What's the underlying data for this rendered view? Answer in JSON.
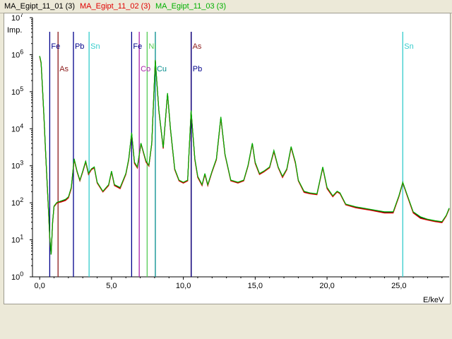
{
  "legend": [
    {
      "label": "MA_Egipt_11_01 (3)",
      "color": "#000000"
    },
    {
      "label": "MA_Egipt_11_02 (3)",
      "color": "#e00000"
    },
    {
      "label": "MA_Egipt_11_03 (3)",
      "color": "#00b000"
    }
  ],
  "chart_data": {
    "type": "line",
    "ylabel": "Imp.",
    "xlabel": "E/keV",
    "yscale": "log",
    "ylim": [
      1,
      10000000
    ],
    "xlim": [
      -0.5,
      28.5
    ],
    "x_ticks": [
      0,
      5,
      10,
      15,
      20,
      25
    ],
    "x_tick_labels": [
      "0,0",
      "5,0",
      "10,0",
      "15,0",
      "20,0",
      "25,0"
    ],
    "y_ticks": [
      1,
      10,
      100,
      1000,
      10000,
      100000,
      1000000,
      10000000
    ],
    "y_tick_labels": [
      "10^0",
      "10^1",
      "10^2",
      "10^3",
      "10^4",
      "10^5",
      "10^6",
      "10^7"
    ],
    "series_colors": [
      "#000000",
      "#e00000",
      "#00b000"
    ],
    "series": [
      {
        "name": "MA_Egipt_11_01 (3)",
        "points": [
          [
            0.0,
            900000
          ],
          [
            0.1,
            600000
          ],
          [
            0.2,
            120000
          ],
          [
            0.3,
            20000
          ],
          [
            0.4,
            3000
          ],
          [
            0.5,
            500
          ],
          [
            0.6,
            80
          ],
          [
            0.7,
            12
          ],
          [
            0.8,
            4
          ],
          [
            0.9,
            30
          ],
          [
            1.0,
            80
          ],
          [
            1.2,
            100
          ],
          [
            1.5,
            110
          ],
          [
            1.8,
            120
          ],
          [
            2.0,
            140
          ],
          [
            2.2,
            250
          ],
          [
            2.4,
            1500
          ],
          [
            2.6,
            700
          ],
          [
            2.8,
            400
          ],
          [
            3.0,
            700
          ],
          [
            3.2,
            1300
          ],
          [
            3.4,
            600
          ],
          [
            3.6,
            800
          ],
          [
            3.8,
            900
          ],
          [
            4.0,
            350
          ],
          [
            4.4,
            200
          ],
          [
            4.8,
            300
          ],
          [
            5.0,
            700
          ],
          [
            5.2,
            300
          ],
          [
            5.6,
            250
          ],
          [
            6.0,
            600
          ],
          [
            6.2,
            1500
          ],
          [
            6.4,
            7500
          ],
          [
            6.6,
            1200
          ],
          [
            6.8,
            900
          ],
          [
            7.05,
            4000
          ],
          [
            7.4,
            1300
          ],
          [
            7.6,
            1000
          ],
          [
            7.8,
            4000
          ],
          [
            8.05,
            700000
          ],
          [
            8.3,
            30000
          ],
          [
            8.6,
            3000
          ],
          [
            8.9,
            90000
          ],
          [
            9.1,
            10000
          ],
          [
            9.4,
            800
          ],
          [
            9.7,
            400
          ],
          [
            10.0,
            350
          ],
          [
            10.3,
            400
          ],
          [
            10.54,
            30000
          ],
          [
            10.8,
            1500
          ],
          [
            11.0,
            500
          ],
          [
            11.3,
            300
          ],
          [
            11.5,
            600
          ],
          [
            11.7,
            300
          ],
          [
            12.0,
            700
          ],
          [
            12.3,
            1500
          ],
          [
            12.61,
            20000
          ],
          [
            12.9,
            2000
          ],
          [
            13.3,
            400
          ],
          [
            13.8,
            350
          ],
          [
            14.2,
            400
          ],
          [
            14.5,
            1000
          ],
          [
            14.8,
            4000
          ],
          [
            15.0,
            1200
          ],
          [
            15.3,
            600
          ],
          [
            15.6,
            700
          ],
          [
            16.0,
            900
          ],
          [
            16.3,
            2500
          ],
          [
            16.6,
            900
          ],
          [
            16.9,
            500
          ],
          [
            17.2,
            800
          ],
          [
            17.5,
            3200
          ],
          [
            17.8,
            1200
          ],
          [
            18.0,
            400
          ],
          [
            18.4,
            200
          ],
          [
            18.8,
            180
          ],
          [
            19.3,
            170
          ],
          [
            19.7,
            900
          ],
          [
            20.0,
            250
          ],
          [
            20.4,
            150
          ],
          [
            20.7,
            200
          ],
          [
            20.9,
            180
          ],
          [
            21.3,
            90
          ],
          [
            22.0,
            75
          ],
          [
            23.0,
            65
          ],
          [
            24.0,
            55
          ],
          [
            24.6,
            55
          ],
          [
            25.0,
            150
          ],
          [
            25.27,
            350
          ],
          [
            25.6,
            150
          ],
          [
            26.0,
            55
          ],
          [
            26.5,
            40
          ],
          [
            27.0,
            35
          ],
          [
            27.5,
            32
          ],
          [
            28.0,
            30
          ],
          [
            28.3,
            45
          ],
          [
            28.5,
            70
          ]
        ]
      },
      {
        "name": "MA_Egipt_11_02 (3)",
        "points": [
          [
            0.0,
            880000
          ],
          [
            0.1,
            580000
          ],
          [
            0.2,
            115000
          ],
          [
            0.3,
            19000
          ],
          [
            0.4,
            2800
          ],
          [
            0.5,
            480
          ],
          [
            0.6,
            75
          ],
          [
            0.7,
            11
          ],
          [
            0.8,
            4
          ],
          [
            0.9,
            28
          ],
          [
            1.0,
            78
          ],
          [
            1.2,
            98
          ],
          [
            1.5,
            105
          ],
          [
            1.8,
            115
          ],
          [
            2.0,
            135
          ],
          [
            2.2,
            240
          ],
          [
            2.4,
            1450
          ],
          [
            2.6,
            680
          ],
          [
            2.8,
            390
          ],
          [
            3.0,
            680
          ],
          [
            3.2,
            1250
          ],
          [
            3.4,
            580
          ],
          [
            3.6,
            780
          ],
          [
            3.8,
            870
          ],
          [
            4.0,
            340
          ],
          [
            4.4,
            195
          ],
          [
            4.8,
            290
          ],
          [
            5.0,
            680
          ],
          [
            5.2,
            290
          ],
          [
            5.6,
            240
          ],
          [
            6.0,
            580
          ],
          [
            6.2,
            1450
          ],
          [
            6.4,
            7300
          ],
          [
            6.6,
            1150
          ],
          [
            6.8,
            870
          ],
          [
            7.05,
            3900
          ],
          [
            7.4,
            1250
          ],
          [
            7.6,
            980
          ],
          [
            7.8,
            3900
          ],
          [
            8.05,
            690000
          ],
          [
            8.3,
            29000
          ],
          [
            8.6,
            2900
          ],
          [
            8.9,
            88000
          ],
          [
            9.1,
            9800
          ],
          [
            9.4,
            780
          ],
          [
            9.7,
            390
          ],
          [
            10.0,
            340
          ],
          [
            10.3,
            390
          ],
          [
            10.54,
            29000
          ],
          [
            10.8,
            1450
          ],
          [
            11.0,
            480
          ],
          [
            11.3,
            290
          ],
          [
            11.5,
            580
          ],
          [
            11.7,
            290
          ],
          [
            12.0,
            680
          ],
          [
            12.3,
            1450
          ],
          [
            12.61,
            19500
          ],
          [
            12.9,
            1950
          ],
          [
            13.3,
            390
          ],
          [
            13.8,
            340
          ],
          [
            14.2,
            390
          ],
          [
            14.5,
            980
          ],
          [
            14.8,
            3900
          ],
          [
            15.0,
            1150
          ],
          [
            15.3,
            580
          ],
          [
            15.6,
            680
          ],
          [
            16.0,
            880
          ],
          [
            16.3,
            2400
          ],
          [
            16.6,
            880
          ],
          [
            16.9,
            480
          ],
          [
            17.2,
            780
          ],
          [
            17.5,
            3100
          ],
          [
            17.8,
            1150
          ],
          [
            18.0,
            390
          ],
          [
            18.4,
            190
          ],
          [
            18.8,
            175
          ],
          [
            19.3,
            165
          ],
          [
            19.7,
            880
          ],
          [
            20.0,
            240
          ],
          [
            20.4,
            145
          ],
          [
            20.7,
            195
          ],
          [
            20.9,
            175
          ],
          [
            21.3,
            88
          ],
          [
            22.0,
            73
          ],
          [
            23.0,
            63
          ],
          [
            24.0,
            53
          ],
          [
            24.6,
            53
          ],
          [
            25.0,
            145
          ],
          [
            25.27,
            340
          ],
          [
            25.6,
            145
          ],
          [
            26.0,
            53
          ],
          [
            26.5,
            38
          ],
          [
            27.0,
            34
          ],
          [
            27.5,
            31
          ],
          [
            28.0,
            29
          ],
          [
            28.3,
            44
          ],
          [
            28.5,
            68
          ]
        ]
      },
      {
        "name": "MA_Egipt_11_03 (3)",
        "points": [
          [
            0.0,
            920000
          ],
          [
            0.1,
            620000
          ],
          [
            0.2,
            125000
          ],
          [
            0.3,
            21000
          ],
          [
            0.4,
            3100
          ],
          [
            0.5,
            520
          ],
          [
            0.6,
            82
          ],
          [
            0.7,
            12
          ],
          [
            0.8,
            4
          ],
          [
            0.9,
            31
          ],
          [
            1.0,
            82
          ],
          [
            1.2,
            103
          ],
          [
            1.5,
            113
          ],
          [
            1.8,
            124
          ],
          [
            2.0,
            145
          ],
          [
            2.2,
            260
          ],
          [
            2.4,
            1550
          ],
          [
            2.6,
            720
          ],
          [
            2.8,
            410
          ],
          [
            3.0,
            720
          ],
          [
            3.2,
            1350
          ],
          [
            3.4,
            620
          ],
          [
            3.6,
            830
          ],
          [
            3.8,
            930
          ],
          [
            4.0,
            360
          ],
          [
            4.4,
            205
          ],
          [
            4.8,
            310
          ],
          [
            5.0,
            720
          ],
          [
            5.2,
            310
          ],
          [
            5.6,
            260
          ],
          [
            6.0,
            620
          ],
          [
            6.2,
            1550
          ],
          [
            6.4,
            7800
          ],
          [
            6.6,
            1250
          ],
          [
            6.8,
            930
          ],
          [
            7.05,
            4100
          ],
          [
            7.4,
            1350
          ],
          [
            7.6,
            1030
          ],
          [
            7.8,
            4100
          ],
          [
            8.05,
            720000
          ],
          [
            8.3,
            31000
          ],
          [
            8.6,
            3100
          ],
          [
            8.9,
            92000
          ],
          [
            9.1,
            10500
          ],
          [
            9.4,
            830
          ],
          [
            9.7,
            410
          ],
          [
            10.0,
            360
          ],
          [
            10.3,
            410
          ],
          [
            10.54,
            31000
          ],
          [
            10.8,
            1550
          ],
          [
            11.0,
            520
          ],
          [
            11.3,
            310
          ],
          [
            11.5,
            620
          ],
          [
            11.7,
            310
          ],
          [
            12.0,
            720
          ],
          [
            12.3,
            1550
          ],
          [
            12.61,
            21000
          ],
          [
            12.9,
            2050
          ],
          [
            13.3,
            410
          ],
          [
            13.8,
            360
          ],
          [
            14.2,
            410
          ],
          [
            14.5,
            1030
          ],
          [
            14.8,
            4100
          ],
          [
            15.0,
            1250
          ],
          [
            15.3,
            620
          ],
          [
            15.6,
            720
          ],
          [
            16.0,
            930
          ],
          [
            16.3,
            2600
          ],
          [
            16.6,
            930
          ],
          [
            16.9,
            520
          ],
          [
            17.2,
            830
          ],
          [
            17.5,
            3300
          ],
          [
            17.8,
            1250
          ],
          [
            18.0,
            410
          ],
          [
            18.4,
            205
          ],
          [
            18.8,
            185
          ],
          [
            19.3,
            175
          ],
          [
            19.7,
            930
          ],
          [
            20.0,
            260
          ],
          [
            20.4,
            155
          ],
          [
            20.7,
            205
          ],
          [
            20.9,
            185
          ],
          [
            21.3,
            92
          ],
          [
            22.0,
            78
          ],
          [
            23.0,
            67
          ],
          [
            24.0,
            57
          ],
          [
            24.6,
            57
          ],
          [
            25.0,
            155
          ],
          [
            25.27,
            360
          ],
          [
            25.6,
            155
          ],
          [
            26.0,
            57
          ],
          [
            26.5,
            42
          ],
          [
            27.0,
            36
          ],
          [
            27.5,
            33
          ],
          [
            28.0,
            31
          ],
          [
            28.3,
            46
          ],
          [
            28.5,
            72
          ]
        ]
      }
    ],
    "element_markers": [
      {
        "element": "Fe",
        "energy": 6.4,
        "color": "#00008b",
        "label": "Fe"
      },
      {
        "element": "Co",
        "energy": 6.93,
        "color": "#aa22aa",
        "label": "Co"
      },
      {
        "element": "Ni",
        "energy": 7.48,
        "color": "#55cc55",
        "label": "Ni"
      },
      {
        "element": "Cu",
        "energy": 8.05,
        "color": "#008b8b",
        "label": "Cu"
      },
      {
        "element": "As",
        "energy": 10.54,
        "color": "#8b1a1a",
        "label": "As"
      },
      {
        "element": "Pb",
        "energy": 10.55,
        "color": "#00008b",
        "label": "Pb"
      },
      {
        "element": "Pb",
        "energy": 2.35,
        "color": "#00008b",
        "label": "Pb"
      },
      {
        "element": "Sn",
        "energy": 3.44,
        "color": "#33cccc",
        "label": "Sn"
      },
      {
        "element": "Sn",
        "energy": 25.27,
        "color": "#33cccc",
        "label": "Sn"
      },
      {
        "element": "Fe",
        "energy": 0.7,
        "color": "#00008b",
        "label": "Fe"
      },
      {
        "element": "As",
        "energy": 1.28,
        "color": "#8b1a1a",
        "label": "As"
      }
    ]
  }
}
